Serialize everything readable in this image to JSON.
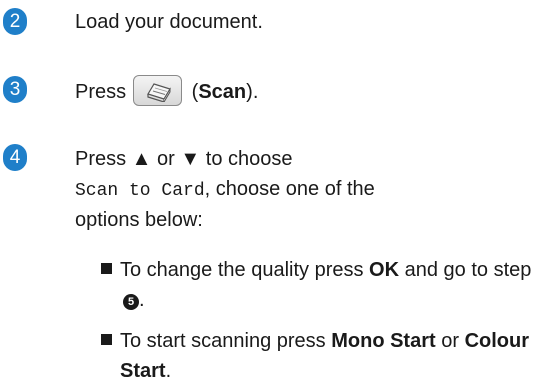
{
  "steps": [
    {
      "number": "2",
      "text": "Load your document."
    },
    {
      "number": "3",
      "pre": "Press",
      "button_name": "Scan",
      "open_paren": " (",
      "close_paren": ")."
    },
    {
      "number": "4",
      "line1_a": "Press",
      "up_arrow": " ▲ ",
      "or": "or",
      "down_arrow": " ▼ ",
      "line1_b": "to choose",
      "menu_item": "Scan to Card",
      "line2_b": ", choose one of the",
      "line3": "options below:",
      "bullets": [
        {
          "pre": "To change the quality press ",
          "key": "OK",
          "mid": " and go to step ",
          "step_ref": "5",
          "post": "."
        },
        {
          "pre": "To start scanning press ",
          "key1": "Mono Start",
          "or": " or ",
          "key2": "Colour Start",
          "post": "."
        }
      ]
    }
  ],
  "colors": {
    "step_badge": "#1f7fc9",
    "text": "#1a1a1a"
  },
  "icons": {
    "scan_button": "scanner-icon",
    "bullet": "square-bullet-icon",
    "step_reference": "circled-number-icon"
  }
}
